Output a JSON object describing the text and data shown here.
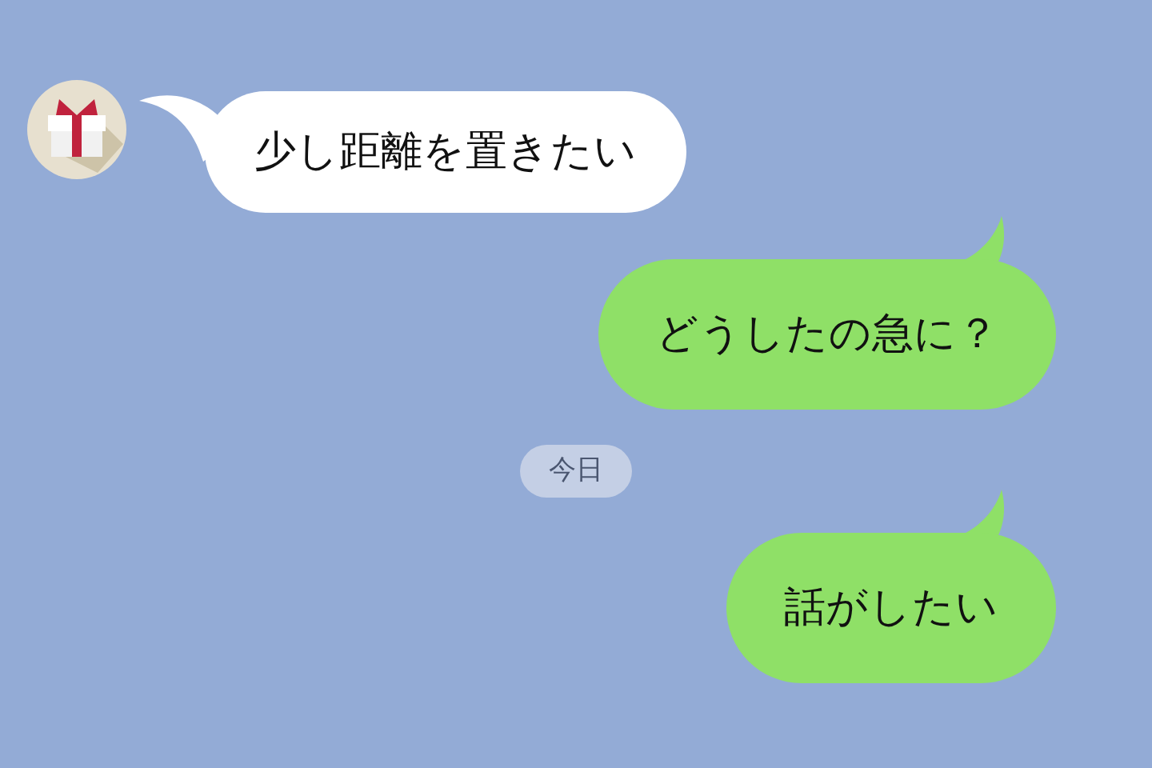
{
  "messages": [
    {
      "kind": "incoming",
      "text": "少し距離を置きたい"
    },
    {
      "kind": "outgoing",
      "text": "どうしたの急に？"
    },
    {
      "kind": "date",
      "text": "今日"
    },
    {
      "kind": "outgoing",
      "text": "話がしたい"
    }
  ]
}
